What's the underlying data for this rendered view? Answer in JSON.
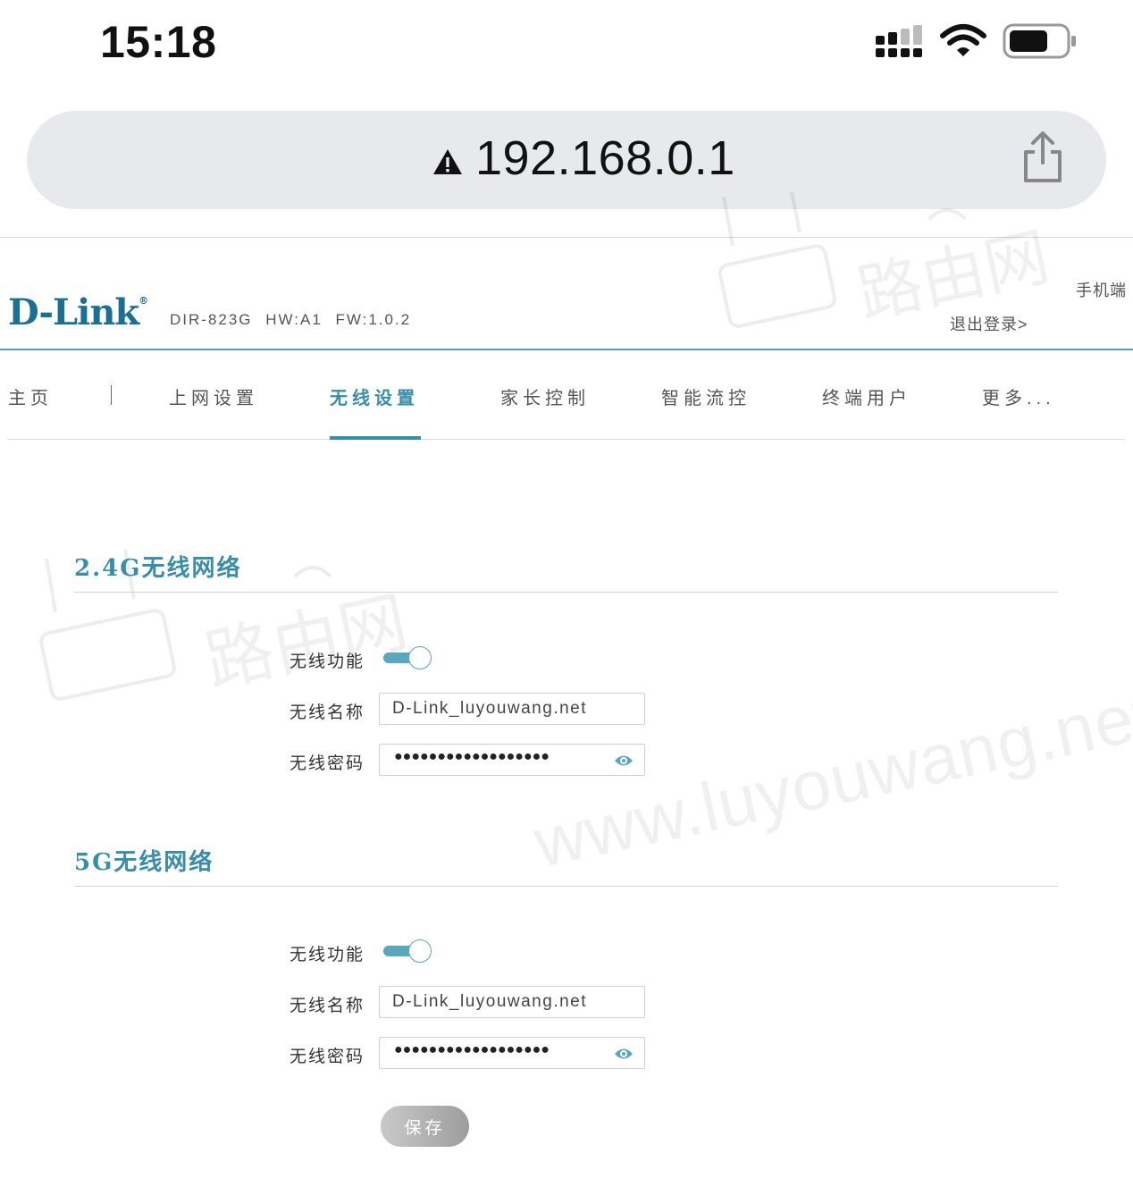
{
  "status_bar": {
    "time": "15:18"
  },
  "browser": {
    "url": "192.168.0.1"
  },
  "router": {
    "brand": "D-Link",
    "model_info": "DIR-823G HW:A1 FW:1.0.2",
    "mobile_link": "手机端",
    "logout_link": "退出登录>"
  },
  "nav": {
    "items": [
      "主页",
      "上网设置",
      "无线设置",
      "家长控制",
      "智能流控",
      "终端用户",
      "更多..."
    ],
    "active": "无线设置"
  },
  "wifi24": {
    "title": "2.4G无线网络",
    "enable_label": "无线功能",
    "enabled": true,
    "ssid_label": "无线名称",
    "ssid": "D-Link_luyouwang.net",
    "password_label": "无线密码",
    "password_mask": "●●●●●●●●●●●●●●●●●●"
  },
  "wifi5": {
    "title": "5G无线网络",
    "enable_label": "无线功能",
    "enabled": true,
    "ssid_label": "无线名称",
    "ssid": "D-Link_luyouwang.net",
    "password_label": "无线密码",
    "password_mask": "●●●●●●●●●●●●●●●●●●"
  },
  "save_label": "保存",
  "watermark": {
    "url": "www.luyouwang.net",
    "name": "路由网"
  },
  "colors": {
    "accent": "#3a8da8",
    "brand": "#1b6f93",
    "toggle": "#5aa6bd"
  }
}
